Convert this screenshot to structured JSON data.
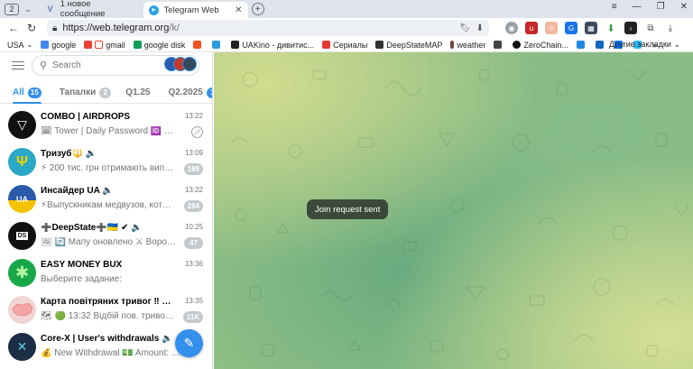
{
  "browser": {
    "tab_counter": "2",
    "tabs": [
      {
        "title": "1 новое сообщение",
        "active": false
      },
      {
        "title": "Telegram Web",
        "active": true
      }
    ],
    "url_host": "https://web.telegram.org",
    "url_path": "/k/",
    "bookmarks": [
      {
        "label": "USA",
        "color": "#ffffff"
      },
      {
        "label": "google",
        "color": "#4285f4"
      },
      {
        "label": "gmail",
        "color": "#ea4335"
      },
      {
        "label": "google disk",
        "color": "#0f9d58"
      },
      {
        "label": "",
        "color": "#f4511e"
      },
      {
        "label": "",
        "color": "#2d9cdb"
      },
      {
        "label": "UAKino - дивитис...",
        "color": "#222222"
      },
      {
        "label": "Сериалы",
        "color": "#e53935"
      },
      {
        "label": "DeepStateMAP",
        "color": "#333333"
      },
      {
        "label": "weather",
        "color": "#6d4c41"
      },
      {
        "label": "",
        "color": "#444444"
      },
      {
        "label": "ZeroChain...",
        "color": "#111111"
      },
      {
        "label": "",
        "color": "#1e88e5"
      },
      {
        "label": "",
        "color": "#1565c0"
      },
      {
        "label": "",
        "color": "#0077ff"
      },
      {
        "label": "",
        "color": "#29b6f6"
      }
    ],
    "bookmarks_more": "»",
    "other_bookmarks": "Другие закладки"
  },
  "telegram": {
    "search_placeholder": "Search",
    "folders": [
      {
        "label": "All",
        "badge": "15",
        "active": true
      },
      {
        "label": "Тапалки",
        "badge": "2",
        "active": false
      },
      {
        "label": "Q1.25",
        "badge": "",
        "active": false
      },
      {
        "label": "Q2.2025",
        "badge": "1",
        "active": false
      }
    ],
    "chats": [
      {
        "title": "COMBO | AIRDROPS",
        "time": "13:22",
        "preview": "🗓 Tower | Daily Password 🆔 Get +...",
        "badge": "",
        "pinned": true,
        "avatar_color": "#111111",
        "avatar_text": "▽"
      },
      {
        "title": "Тризуб🔱 🔈",
        "time": "13:09",
        "preview": "⚡ 200 тис. грн отримають випуск...",
        "badge": "189",
        "pinned": false,
        "avatar_color": "#2aa8c8",
        "avatar_text": "Ψ"
      },
      {
        "title": "Инсайдер UA 🔈",
        "time": "13:22",
        "preview": "⚡Выпускникам медвузов, которы...",
        "badge": "284",
        "pinned": false,
        "avatar_color": "#2a5aa8",
        "avatar_text": "UA"
      },
      {
        "title": "➕DeepState➕🇺🇦 ✔ 🔈",
        "time": "10:25",
        "preview": "🖼 🔄 Мапу оновлено ⚔ Ворог оку...",
        "badge": "47",
        "pinned": false,
        "avatar_color": "#111111",
        "avatar_text": "DS"
      },
      {
        "title": "EASY MONEY BUX",
        "time": "13:36",
        "preview": "Выберите задание:",
        "badge": "",
        "pinned": false,
        "avatar_color": "#18a84a",
        "avatar_text": "✱"
      },
      {
        "title": "Карта повітряних тривог ‼ Вибу... 🔈",
        "time": "13:35",
        "preview": "🗺 🟢 13:32 Відбій пов. тривоги в ...",
        "badge": "11K",
        "pinned": false,
        "avatar_color": "#f2d4d4",
        "avatar_text": ""
      },
      {
        "title": "Core-X | User's withdrawals 🔈",
        "time": "",
        "preview": "💰 New Withdrawal 💵 Amount: 0.001",
        "badge": "",
        "pinned": false,
        "avatar_color": "#1c2e44",
        "avatar_text": "✕"
      }
    ],
    "toast": "Join request sent"
  }
}
